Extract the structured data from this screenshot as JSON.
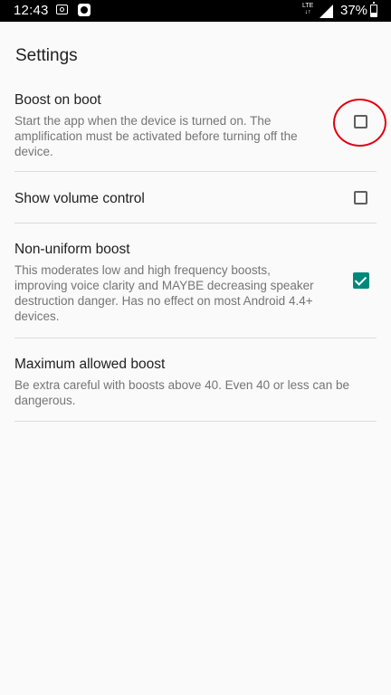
{
  "status_bar": {
    "time": "12:43",
    "network": "LTE",
    "battery": "37%",
    "icons": [
      "screenshot-icon",
      "app-notification-icon",
      "lte-icon",
      "signal-icon",
      "battery-icon"
    ]
  },
  "header": {
    "title": "Settings"
  },
  "preferences": [
    {
      "title": "Boost on boot",
      "summary": "Start the app when the device is turned on. The amplification must be activated before turning off the device.",
      "checked": false
    },
    {
      "title": "Show volume control",
      "summary": "",
      "checked": false
    },
    {
      "title": "Non-uniform boost",
      "summary": "This moderates low and high frequency boosts, improving voice clarity and MAYBE decreasing speaker destruction danger. Has no effect on most Android 4.4+ devices.",
      "checked": true
    },
    {
      "title": "Maximum allowed boost",
      "summary": "Be extra careful with boosts above 40. Even 40 or less can be dangerous."
    }
  ],
  "colors": {
    "accent": "#00897b",
    "highlight_ring": "#e30010",
    "background": "#fafafa"
  }
}
